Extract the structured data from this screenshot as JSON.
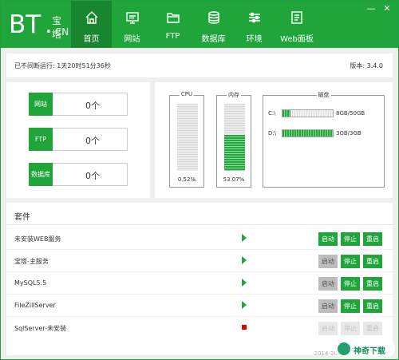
{
  "app": {
    "logo_text": "BT",
    "logo_cn_top": "宝塔",
    "logo_cn_bottom": ".CN",
    "window_minimize": "—",
    "window_close": "✕"
  },
  "nav": [
    {
      "label": "首页",
      "icon": "home-icon",
      "active": true
    },
    {
      "label": "网站",
      "icon": "monitor-icon",
      "active": false
    },
    {
      "label": "FTP",
      "icon": "folder-icon",
      "active": false
    },
    {
      "label": "数据库",
      "icon": "database-icon",
      "active": false
    },
    {
      "label": "环境",
      "icon": "sliders-icon",
      "active": false
    },
    {
      "label": "Web面板",
      "icon": "document-icon",
      "active": false
    }
  ],
  "status": {
    "uptime": "已不间断运行: 1天20时51分36秒",
    "version": "版本: 3.4.0"
  },
  "stats": [
    {
      "label": "网站",
      "value": "0个"
    },
    {
      "label": "FTP",
      "value": "0个"
    },
    {
      "label": "数据库",
      "value": "0个"
    }
  ],
  "resources": {
    "cpu": {
      "title": "CPU",
      "percent_label": "0.52%",
      "percent": 0.52
    },
    "memory": {
      "title": "内存",
      "percent_label": "53.07%",
      "percent": 53.07
    },
    "disk": {
      "title": "磁盘",
      "drives": [
        {
          "label": "C:\\",
          "usage": "8GB/50GB",
          "fraction": 0.16
        },
        {
          "label": "D:\\",
          "usage": "3GB/3GB",
          "fraction": 1.0
        }
      ]
    }
  },
  "plugins": {
    "header": "套件",
    "buttons": {
      "start": "启动",
      "stop": "停止",
      "restart": "重启"
    },
    "items": [
      {
        "name": "未安装WEB服务",
        "status": "running"
      },
      {
        "name": "宝塔-主服务",
        "status": "running"
      },
      {
        "name": "MySQL5.5",
        "status": "running"
      },
      {
        "name": "FileZillServer",
        "status": "running"
      },
      {
        "name": "SqlServer-未安装",
        "status": "stopped"
      }
    ]
  },
  "footer": {
    "copyright": "2014-2017 ©",
    "watermark": "神奇下载"
  },
  "colors": {
    "brand": "#20a53a",
    "nav_active": "#17862e",
    "stopped": "#e20000"
  }
}
